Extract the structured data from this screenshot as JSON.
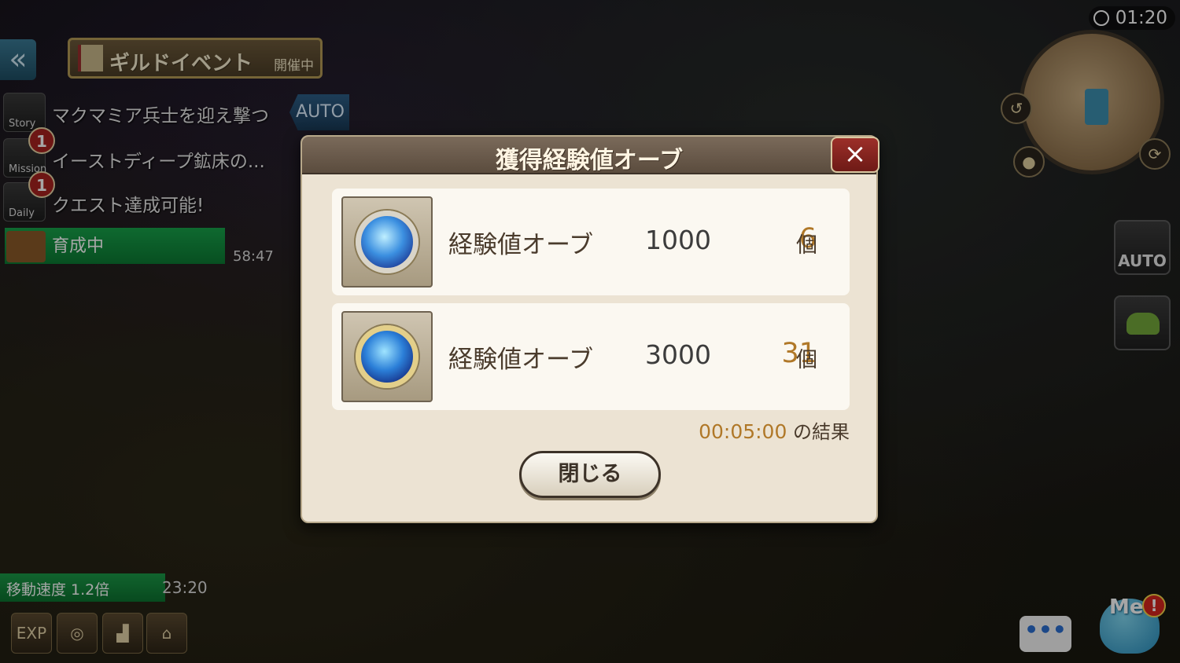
{
  "hud": {
    "guild_event": {
      "title": "ギルドイベント",
      "status": "開催中"
    },
    "quests": [
      {
        "icon_label": "Story",
        "text": "マクマミア兵士を迎え撃つ",
        "badge": ""
      },
      {
        "icon_label": "Mission",
        "text": "イーストディープ鉱床の...",
        "badge": "1"
      },
      {
        "icon_label": "Daily",
        "text": "クエスト達成可能!",
        "badge": "1"
      }
    ],
    "auto_label": "AUTO",
    "training": {
      "label": "育成中",
      "time": "58:47"
    },
    "speed": {
      "label": "移動速度 1.2倍",
      "time": "23:20"
    },
    "bottom_buttons": [
      "EXP"
    ],
    "clock": "01:20",
    "side_auto_label": "AUTO",
    "chat_label": "•••",
    "me_label": "Me",
    "me_alert": "!"
  },
  "dialog": {
    "title": "獲得経験値オーブ",
    "close_icon": "×",
    "items": [
      {
        "name": "経験値オーブ",
        "value": "1000",
        "count": "6",
        "unit": "個",
        "icon": "exp-orb-small-icon"
      },
      {
        "name": "経験値オーブ",
        "value": "3000",
        "count": "31",
        "unit": "個",
        "icon": "exp-orb-large-icon"
      }
    ],
    "result_time": "00:05:00",
    "result_suffix": "の結果",
    "close_button": "閉じる"
  },
  "colors": {
    "accent_gold": "#b07828",
    "dialog_bg": "#ece3d3",
    "header_brown": "#6a5a4b",
    "close_red": "#8a2620",
    "bar_green": "#129a44"
  }
}
